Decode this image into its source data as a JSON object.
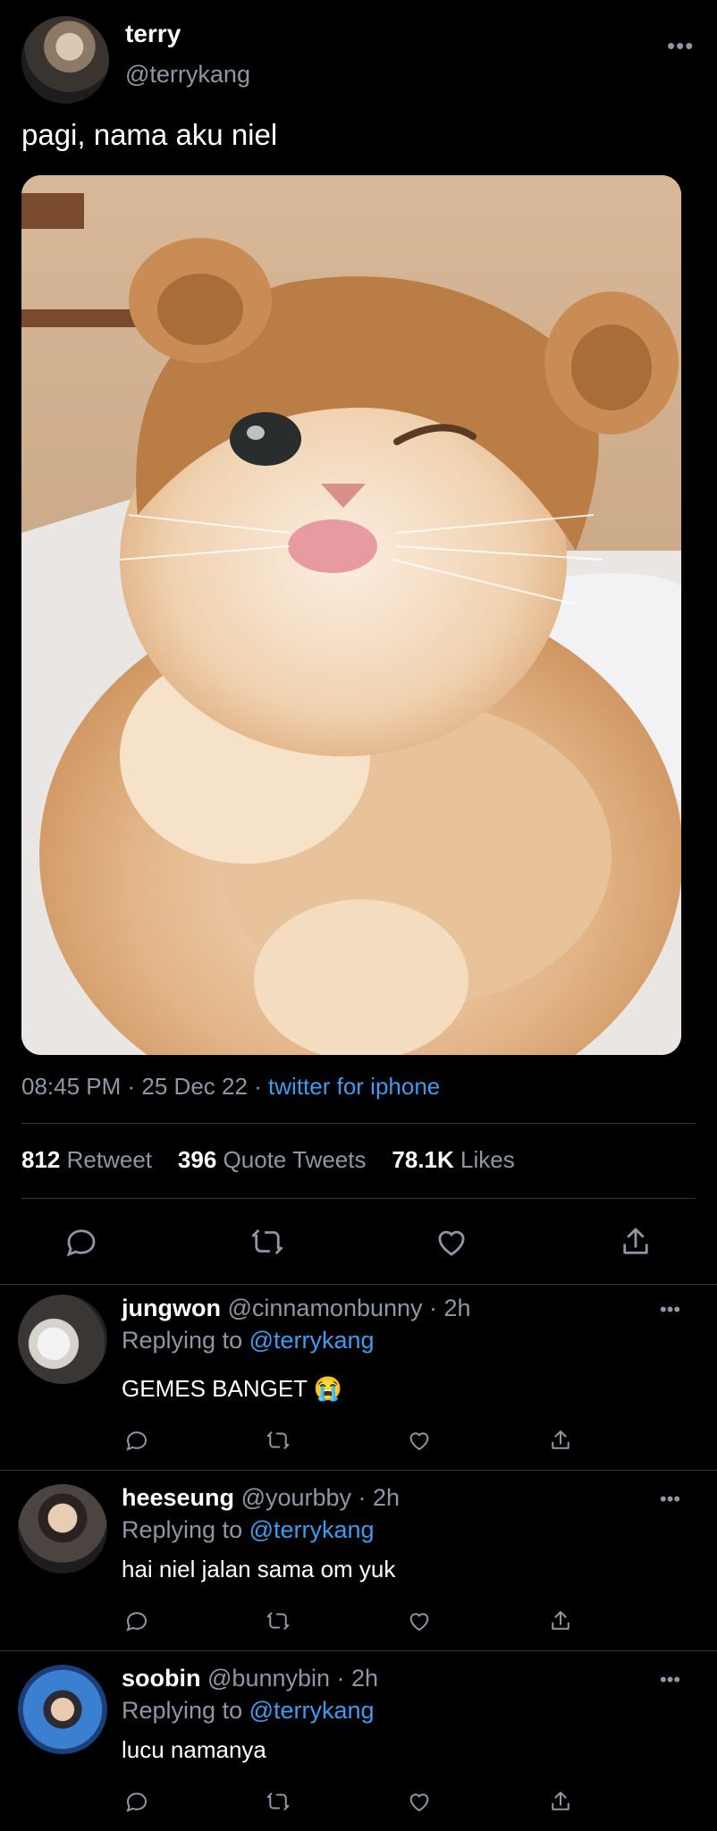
{
  "tweet": {
    "author_name": "terry",
    "author_handle": "@terrykang",
    "more": "•••",
    "text": "pagi, nama aku niel",
    "time": "08:45 PM",
    "date": "25 Dec 22",
    "source": "twitter for iphone",
    "stats": {
      "retweets_count": "812",
      "retweets_label": "Retweet",
      "quotes_count": "396",
      "quotes_label": "Quote Tweets",
      "likes_count": "78.1K",
      "likes_label": "Likes"
    },
    "actions": [
      "reply-icon",
      "retweet-icon",
      "like-icon",
      "share-icon"
    ]
  },
  "replies": [
    {
      "name": "jungwon",
      "handle": "@cinnamonbunny",
      "time": "2h",
      "replying_prefix": "Replying to",
      "mention": "@terrykang",
      "text": "GEMES BANGET",
      "emoji": "😭",
      "more": "•••"
    },
    {
      "name": "heeseung",
      "handle": "@yourbby",
      "time": "2h",
      "replying_prefix": "Replying to",
      "mention": "@terrykang",
      "text": "hai niel jalan sama om yuk",
      "more": "•••"
    },
    {
      "name": "soobin",
      "handle": "@bunnybin",
      "time": "2h",
      "replying_prefix": "Replying to",
      "mention": "@terrykang",
      "text": "lucu namanya",
      "more": "•••"
    }
  ],
  "colors": {
    "background": "#000000",
    "text": "#e7e9ea",
    "muted": "#8b98a5",
    "link": "#3d9bf0",
    "divider": "#2f3336"
  }
}
